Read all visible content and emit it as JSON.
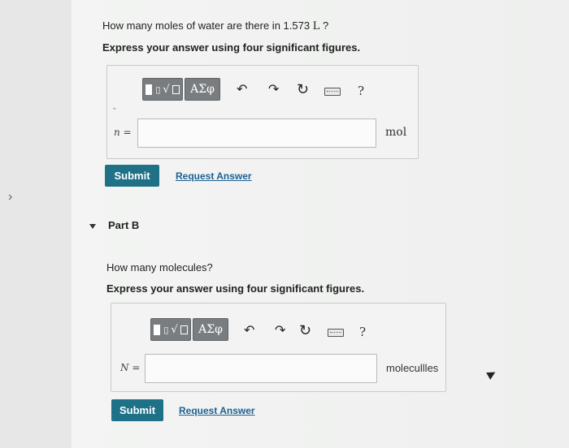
{
  "part_a": {
    "question_prefix": "How many moles of water are there in 1.573 ",
    "question_unit": "L",
    "question_suffix": " ?",
    "instruction": "Express your answer using four significant figures.",
    "variable": "n =",
    "unit": "mol",
    "submit_label": "Submit",
    "request_label": "Request Answer"
  },
  "part_b": {
    "title": "Part B",
    "question": "How many molecules?",
    "instruction": "Express your answer using four significant figures.",
    "variable": "N =",
    "unit": "molecullles",
    "submit_label": "Submit",
    "request_label": "Request Answer"
  },
  "toolbar": {
    "greek_label": "ΑΣφ",
    "help_label": "?",
    "icons": [
      "templates-icon",
      "greek-letters-icon",
      "undo-icon",
      "redo-icon",
      "reset-icon",
      "keyboard-icon",
      "help-icon"
    ]
  },
  "colors": {
    "submit": "#1e7187",
    "link": "#1d5f92",
    "toolbar_button": "#7a7d80"
  }
}
